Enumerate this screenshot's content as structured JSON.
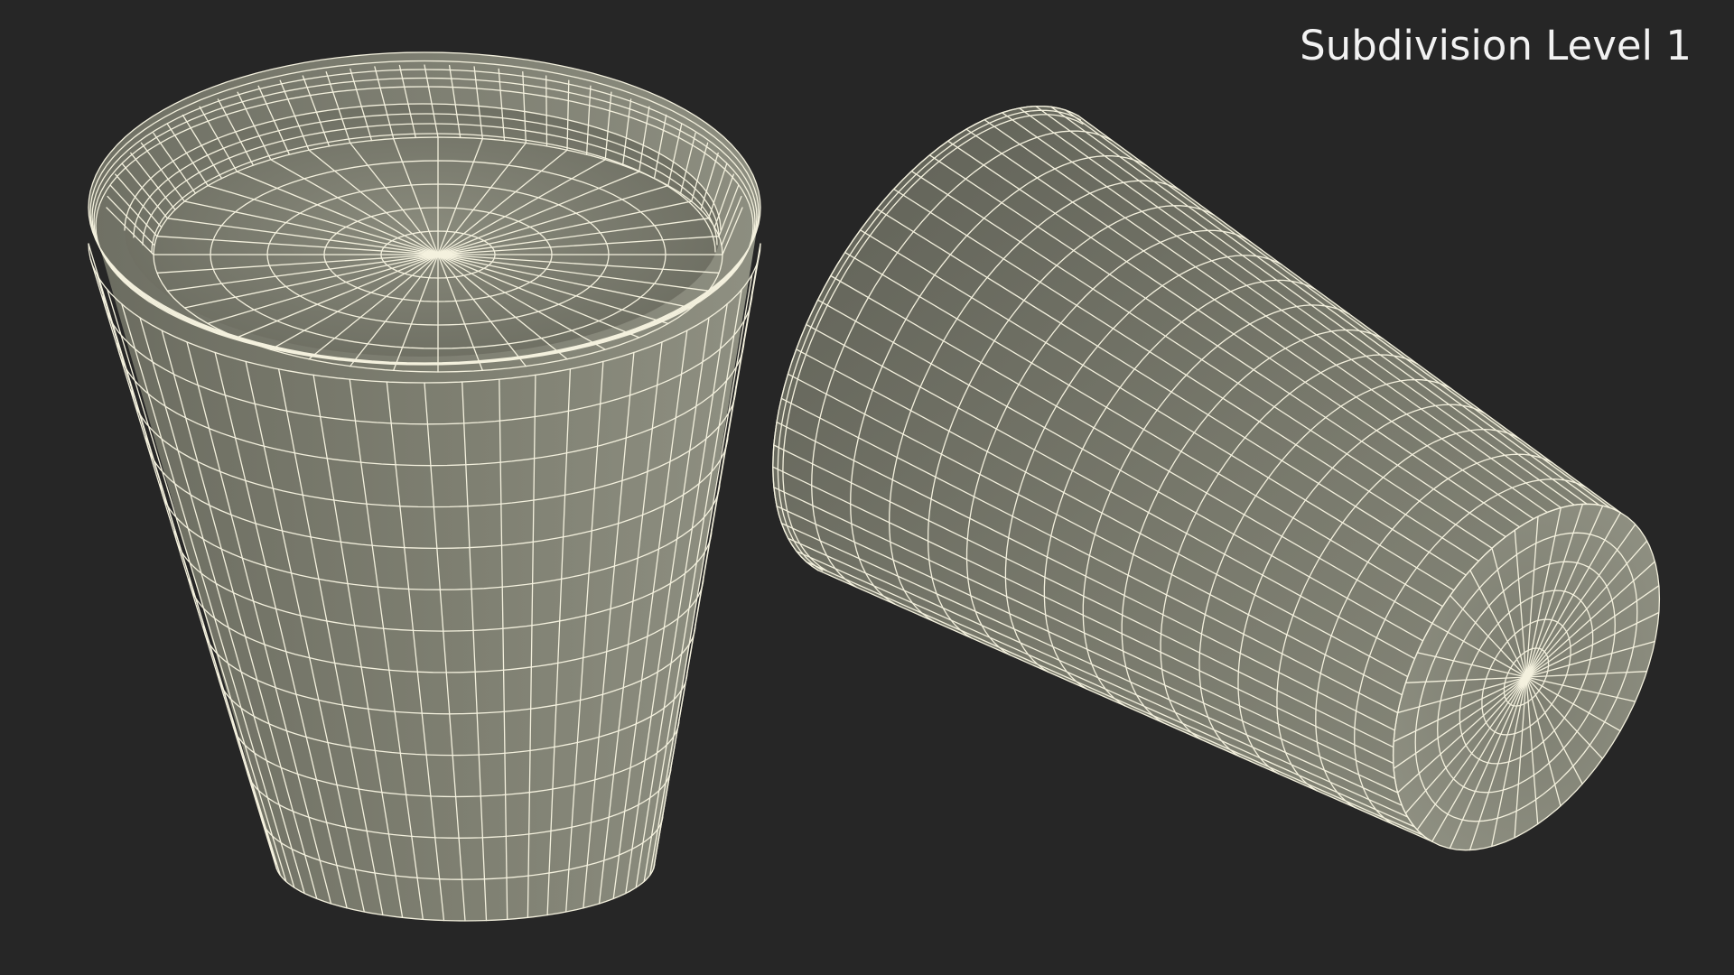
{
  "caption": "Subdivision Level 1",
  "colors": {
    "background": "#262626",
    "mesh_fill_light": "#8a8a7c",
    "mesh_fill_dark": "#5c5d53",
    "wire": "#f4f1de",
    "caption": "#f2f2f2"
  },
  "objects": [
    {
      "name": "cup-upright",
      "view": "upright, opening facing up"
    },
    {
      "name": "cup-tilted",
      "view": "lying on side, base facing right"
    }
  ]
}
